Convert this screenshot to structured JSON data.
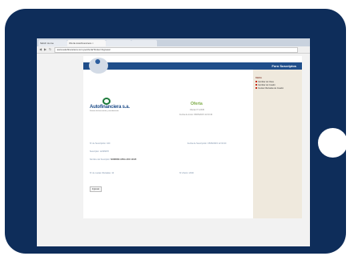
{
  "browser": {
    "tabs": [
      "Skitch Home",
      "Oferta Autofinanciera",
      "",
      ""
    ],
    "url": "www.autofinanciera.com.pe/oferta?index=Ingresar"
  },
  "header": {
    "title": "Foro Suscriptos"
  },
  "brand": {
    "name": "Autofinanciera s.a.",
    "tagline": "Sistema de financiación y arrendamiento"
  },
  "offer": {
    "title": "Oferta",
    "number": "Oferta Nº 12345",
    "date": "Fecha de inicio: 05/05/2015 12:33:40"
  },
  "info": {
    "line1": "Nº de Suscripción: 100",
    "line1b": "Fecha de Suscripción: 05/05/2015 12:33:40",
    "line2": "Suscriptor: 12345678",
    "line3_label": "Nombre del Suscriptor:",
    "line3_value": "NOMBRE APELLIDO 12345",
    "line4": "Nº de cuotas Ofertadas: 10",
    "line4b": "Nº Ahorro: 2000"
  },
  "actions": {
    "ingresar_label": "Ingresar"
  },
  "sidebar": {
    "title": "Inicio",
    "items": [
      "Cambiar de Clave",
      "Cambiar de Cuadro",
      "Cuotas Ofertadas de Cuadro"
    ]
  },
  "colors": {
    "tablet": "#0e2d5a",
    "header": "#1f4e8a",
    "accent": "#7cab45",
    "sidebar": "#efe9dd"
  }
}
